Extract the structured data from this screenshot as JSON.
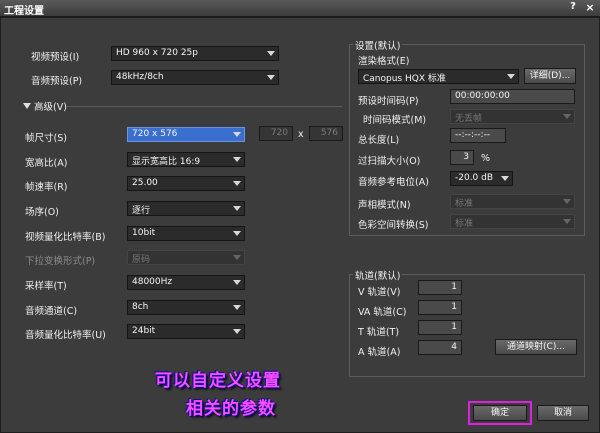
{
  "window": {
    "title": "工程设置",
    "help": "?",
    "close": "×"
  },
  "presets": {
    "video_label": "视频预设(I)",
    "video_value": "HD 960 x 720 25p",
    "audio_label": "音频预设(P)",
    "audio_value": "48kHz/8ch"
  },
  "advanced": {
    "label": "高级(V)"
  },
  "fields": {
    "frame_size_label": "帧尺寸(S)",
    "frame_size_value": "720 x 576",
    "frame_w": "720",
    "frame_x": "x",
    "frame_h": "576",
    "aspect_label": "宽高比(A)",
    "aspect_value": "显示宽高比 16:9",
    "fps_label": "帧速率(R)",
    "fps_value": "25.00",
    "field_order_label": "场序(O)",
    "field_order_value": "逐行",
    "bitdepth_label": "视频量化比特率(B)",
    "bitdepth_value": "10bit",
    "pulldown_label": "下拉变换形式(P)",
    "pulldown_value": "原码",
    "samplerate_label": "采样率(T)",
    "samplerate_value": "48000Hz",
    "channels_label": "音频通道(C)",
    "channels_value": "8ch",
    "audio_bits_label": "音频量化比特率(U)",
    "audio_bits_value": "24bit"
  },
  "settings_group": {
    "title": "设置(默认)",
    "render_label": "渲染格式(E)",
    "render_value": "Canopus HQX 标准",
    "detail_button": "详细(D)...",
    "timecode_label": "预设时间码(P)",
    "timecode_value": "00:00:00:00",
    "tc_mode_label": "时间码模式(M)",
    "tc_mode_value": "无丢帧",
    "length_label": "总长度(L)",
    "length_value": "--:--:--:--",
    "overscan_label": "过扫描大小(O)",
    "overscan_value": "3",
    "overscan_unit": "%",
    "audio_ref_label": "音频参考电位(A)",
    "audio_ref_value": "-20.0 dB",
    "phase_label": "声相模式(N)",
    "phase_value": "标准",
    "colorspace_label": "色彩空间转换(S)",
    "colorspace_value": "标准"
  },
  "tracks_group": {
    "title": "轨道(默认)",
    "v_label": "V 轨道(V)",
    "v_value": "1",
    "va_label": "VA 轨道(C)",
    "va_value": "1",
    "t_label": "T 轨道(T)",
    "t_value": "1",
    "a_label": "A 轨道(A)",
    "a_value": "4",
    "map_button": "通道映射(C)..."
  },
  "annotation": {
    "line1": "可以自定义设置",
    "line2": "相关的参数"
  },
  "footer": {
    "ok": "确定",
    "cancel": "取消"
  },
  "colors": {
    "highlight": "#3a6fd0",
    "annotation": "#ff4dff",
    "ok_border": "#e020e0"
  }
}
